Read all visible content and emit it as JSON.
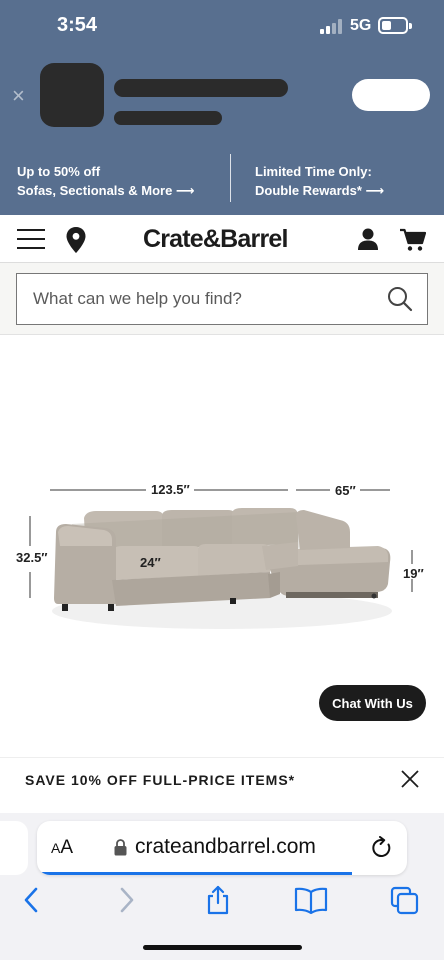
{
  "status_bar": {
    "time": "3:54",
    "network": "5G"
  },
  "smart_banner": {
    "close_glyph": "×"
  },
  "promo_banners": [
    {
      "line1": "Up to 50% off",
      "line2": "Sofas, Sectionals & More ⟶"
    },
    {
      "line1": "Limited Time Only:",
      "line2": "Double Rewards* ⟶"
    }
  ],
  "header": {
    "logo": "Crate&Barrel"
  },
  "search": {
    "placeholder": "What can we help you find?"
  },
  "product": {
    "dimensions": {
      "width": "123.5″",
      "chaise_width": "65″",
      "height": "32.5″",
      "seat_depth": "24″",
      "seat_height": "19″"
    }
  },
  "chat": {
    "label": "Chat With Us"
  },
  "promo_strip": {
    "text": "SAVE 10% OFF FULL-PRICE ITEMS*"
  },
  "browser": {
    "aa_big": "A",
    "aa_small": "A",
    "url": "crateandbarrel.com",
    "load_progress": 0.85
  },
  "colors": {
    "banner_bg": "#586f8f",
    "chat_bg": "#1c1c1c",
    "ios_blue": "#1a73e8",
    "sofa": "#b9b1a6"
  },
  "icons": [
    "hamburger-icon",
    "location-pin-icon",
    "account-icon",
    "cart-icon",
    "search-icon",
    "close-icon",
    "lock-icon",
    "reload-icon",
    "back-icon",
    "forward-icon",
    "share-icon",
    "bookmarks-icon",
    "tabs-icon"
  ]
}
